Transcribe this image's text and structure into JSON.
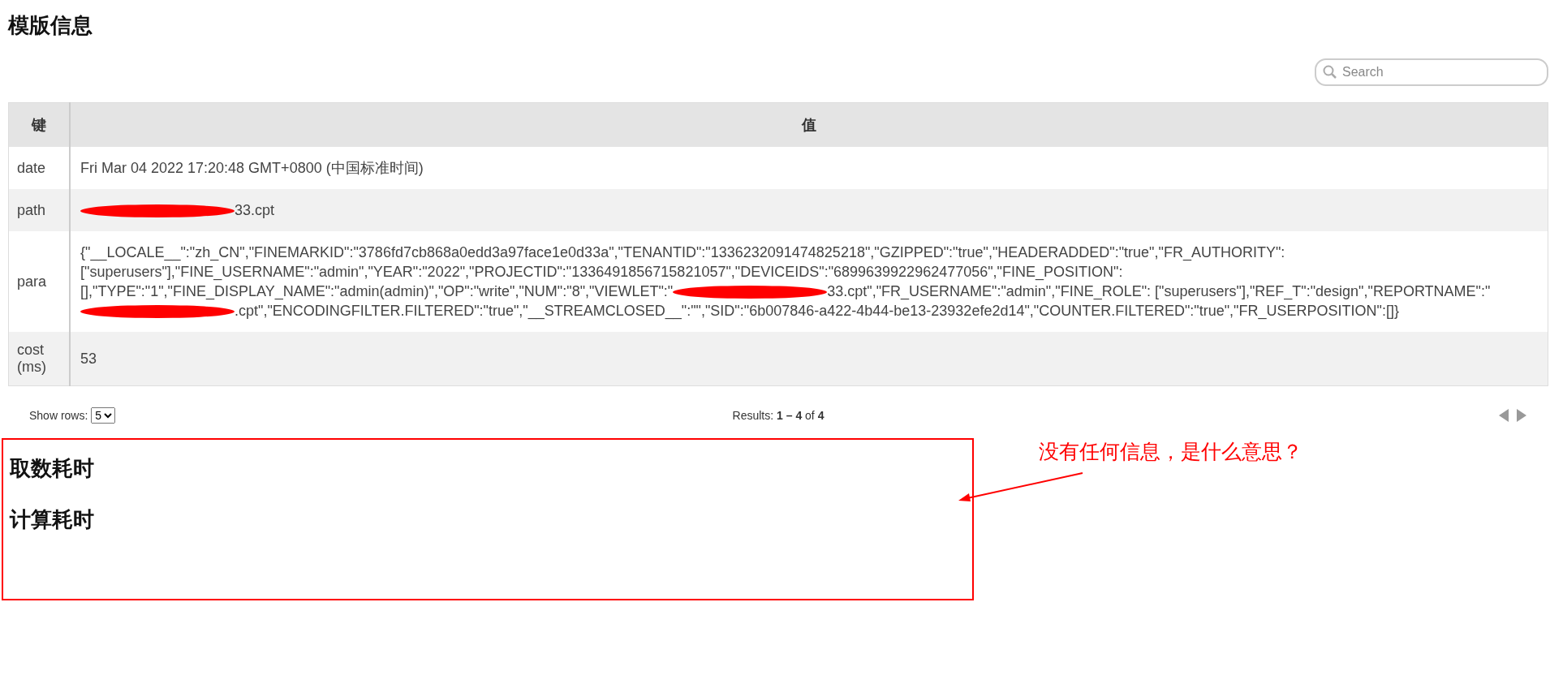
{
  "title": "模版信息",
  "search": {
    "placeholder": "Search"
  },
  "table": {
    "columns": [
      "键",
      "值"
    ],
    "rows": [
      {
        "key": "date",
        "value": [
          {
            "kind": "text",
            "text": "Fri Mar 04 2022 17:20:48 GMT+0800 (中国标准时间)"
          }
        ]
      },
      {
        "key": "path",
        "value": [
          {
            "kind": "redaction"
          },
          {
            "kind": "text",
            "text": "33.cpt"
          }
        ]
      },
      {
        "key": "para",
        "value": [
          {
            "kind": "text",
            "text": "{\"__LOCALE__\":\"zh_CN\",\"FINEMARKID\":\"3786fd7cb868a0edd3a97face1e0d33a\",\"TENANTID\":\"1336232091474825218\",\"GZIPPED\":\"true\",\"HEADERADDED\":\"true\",\"FR_AUTHORITY\": [\"superusers\"],\"FINE_USERNAME\":\"admin\",\"YEAR\":\"2022\",\"PROJECTID\":\"1336491856715821057\",\"DEVICEIDS\":\"6899639922962477056\",\"FINE_POSITION\": [],\"TYPE\":\"1\",\"FINE_DISPLAY_NAME\":\"admin(admin)\",\"OP\":\"write\",\"NUM\":\"8\",\"VIEWLET\":\""
          },
          {
            "kind": "redaction"
          },
          {
            "kind": "text",
            "text": "33.cpt\",\"FR_USERNAME\":\"admin\",\"FINE_ROLE\": [\"superusers\"],\"REF_T\":\"design\",\"REPORTNAME\":\""
          },
          {
            "kind": "redaction"
          },
          {
            "kind": "text",
            "text": ".cpt\",\"ENCODINGFILTER.FILTERED\":\"true\",\"__STREAMCLOSED__\":\"\",\"SID\":\"6b007846-a422-4b44-be13-23932efe2d14\",\"COUNTER.FILTERED\":\"true\",\"FR_USERPOSITION\":[]}"
          }
        ]
      },
      {
        "key": "cost (ms)",
        "value": [
          {
            "kind": "text",
            "text": "53"
          }
        ]
      }
    ]
  },
  "pager": {
    "rows_label": "Show rows:",
    "rows_value": "5",
    "results_label": "Results:",
    "range": "1 – 4",
    "of": "of",
    "total": "4"
  },
  "sections": [
    "取数耗时",
    "计算耗时"
  ],
  "annotation": "没有任何信息，是什么意思？"
}
